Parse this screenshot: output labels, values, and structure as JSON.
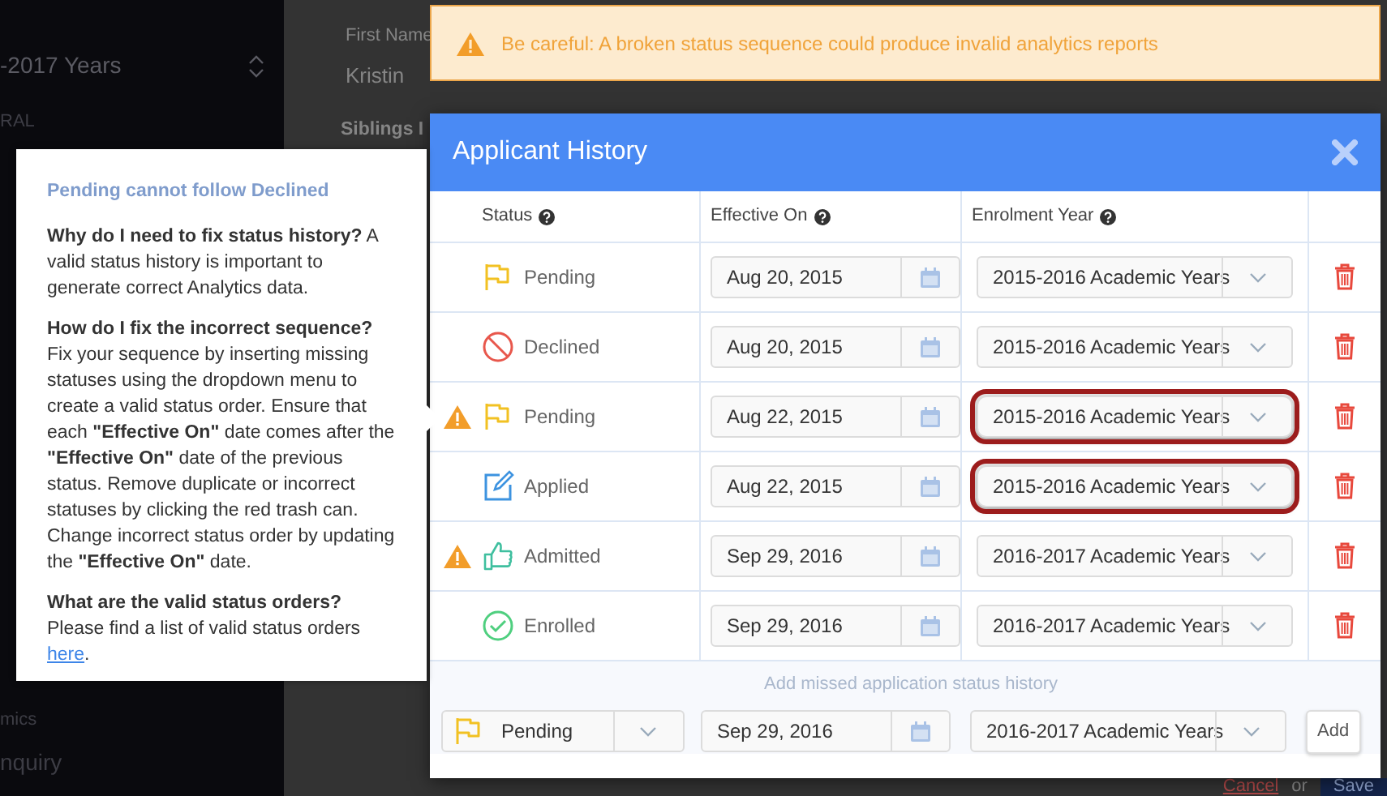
{
  "background": {
    "sidebar": {
      "term": "-2017 Years",
      "top_items": [
        "RAL"
      ],
      "bottom_items": [
        "mics",
        "nquiry"
      ]
    },
    "content": {
      "field_label": "First Name",
      "field_value": "Kristin",
      "section": "Siblings I",
      "cancel": "Cancel",
      "or": "or",
      "save": "Save"
    }
  },
  "alert": {
    "text": "Be careful: A broken status sequence could produce invalid analytics reports"
  },
  "popover": {
    "title": "Pending cannot follow Declined",
    "paragraphs": [
      {
        "text": "**Why do I need to fix status history?** A valid status history is important to generate correct Analytics data."
      },
      {
        "text": "**How do I fix the incorrect sequence?** Fix your sequence by inserting missing statuses using the dropdown menu to create a valid status order. Ensure that each **\"Effective On\"** date comes after the **\"Effective On\"** date of the previous status. Remove duplicate or incorrect statuses by clicking the red trash can. Change incorrect status order by updating the **\"Effective On\"** date."
      },
      {
        "text": "**What are the valid status orders?** Please find a list of valid status orders ",
        "link": "here",
        "after": "."
      }
    ]
  },
  "modal": {
    "title": "Applicant History",
    "columns": [
      "Status",
      "Effective On",
      "Enrolment Year"
    ],
    "rows": [
      {
        "status": "Pending",
        "kind": "pending",
        "warning": false,
        "date": "Aug 20, 2015",
        "year": "2015-2016 Academic Years",
        "highlighted": false
      },
      {
        "status": "Declined",
        "kind": "declined",
        "warning": false,
        "date": "Aug 20, 2015",
        "year": "2015-2016 Academic Years",
        "highlighted": false
      },
      {
        "status": "Pending",
        "kind": "pending",
        "warning": true,
        "date": "Aug 22, 2015",
        "year": "2015-2016 Academic Years",
        "highlighted": true
      },
      {
        "status": "Applied",
        "kind": "applied",
        "warning": false,
        "date": "Aug 22, 2015",
        "year": "2015-2016 Academic Years",
        "highlighted": true
      },
      {
        "status": "Admitted",
        "kind": "admitted",
        "warning": true,
        "date": "Sep 29, 2016",
        "year": "2016-2017 Academic Years",
        "highlighted": false
      },
      {
        "status": "Enrolled",
        "kind": "enrolled",
        "warning": false,
        "date": "Sep 29, 2016",
        "year": "2016-2017 Academic Years",
        "highlighted": false
      }
    ],
    "add_section": {
      "caption": "Add missed application status history",
      "status": {
        "label": "Pending",
        "kind": "pending"
      },
      "date": "Sep 29, 2016",
      "year": "2016-2017 Academic Years",
      "button": "Add"
    }
  }
}
